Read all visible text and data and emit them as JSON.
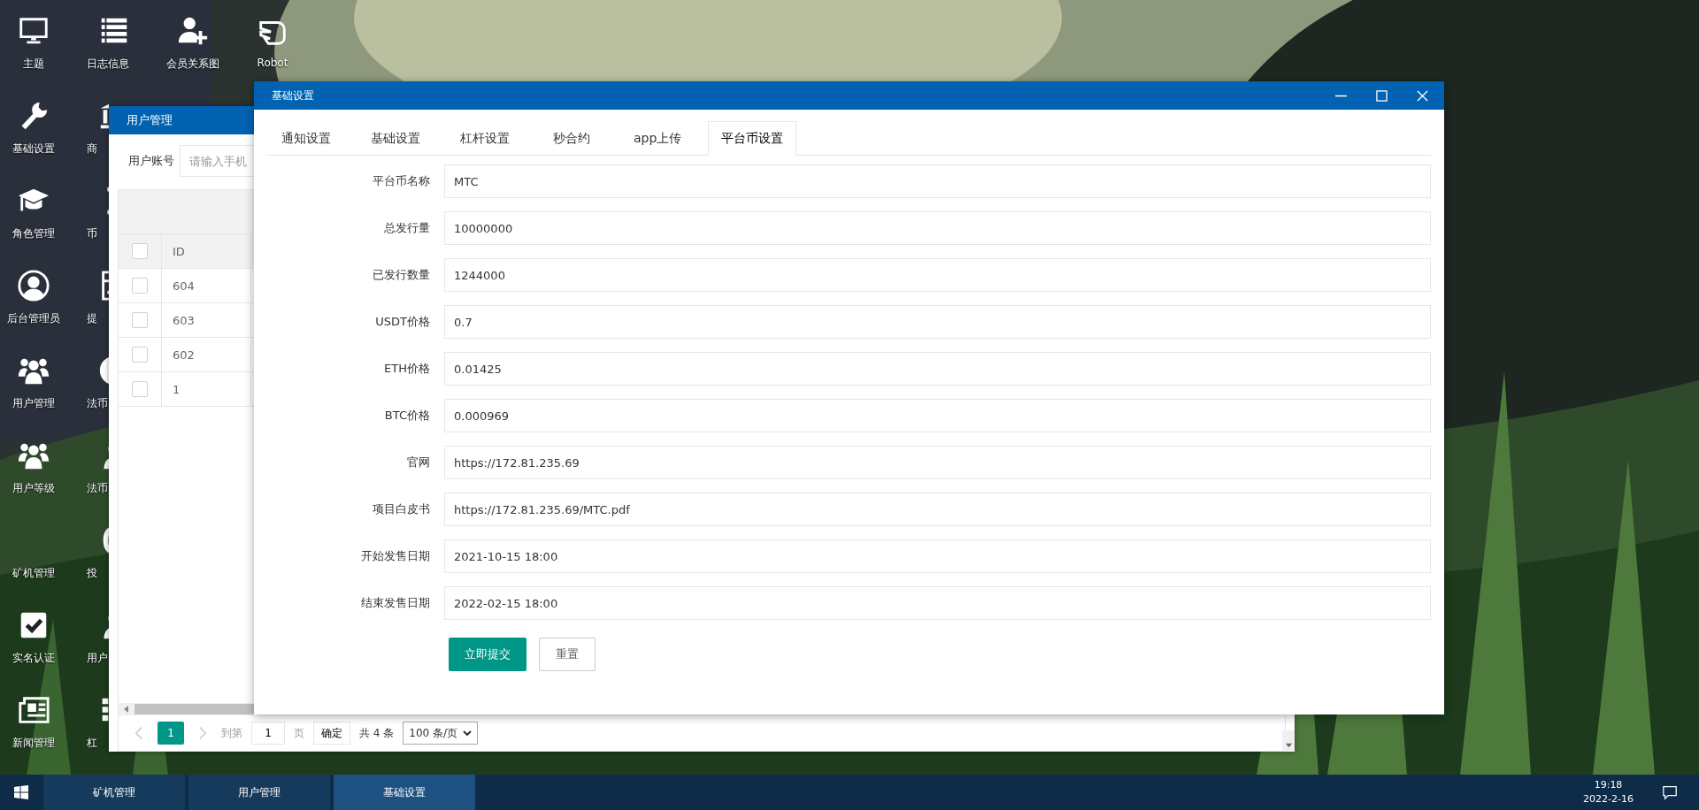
{
  "desktop": {
    "columns": [
      [
        {
          "label": "主题"
        },
        {
          "label": "基础设置"
        },
        {
          "label": "角色管理"
        },
        {
          "label": "后台管理员"
        },
        {
          "label": "用户管理"
        },
        {
          "label": "用户等级"
        },
        {
          "label": "矿机管理"
        },
        {
          "label": "实名认证"
        },
        {
          "label": "新闻管理"
        }
      ],
      [
        {
          "label": "日志信息"
        },
        {
          "label": "商"
        },
        {
          "label": "币"
        },
        {
          "label": "提"
        },
        {
          "label": "法币"
        },
        {
          "label": "法币"
        },
        {
          "label": "投"
        },
        {
          "label": "用户"
        },
        {
          "label": "杠"
        }
      ],
      [
        {
          "label": "会员关系图"
        }
      ],
      [
        {
          "label": "Robot"
        }
      ]
    ]
  },
  "user_window": {
    "title": "用户管理",
    "search_label": "用户账号",
    "search_placeholder": "请输入手机",
    "table": {
      "columns": [
        "ID"
      ],
      "header_checked": false,
      "rows": [
        {
          "id": "604",
          "checked": false
        },
        {
          "id": "603",
          "checked": false
        },
        {
          "id": "602",
          "checked": false
        },
        {
          "id": "1",
          "checked": false
        }
      ]
    },
    "pagination": {
      "pages": [
        {
          "label": "1",
          "selected": true
        }
      ],
      "goto_label": "到第",
      "goto_value": "1",
      "page_unit": "页",
      "confirm": "确定",
      "total": "共 4 条",
      "page_size": "100 条/页"
    }
  },
  "dialog": {
    "title": "基础设置",
    "tabs": [
      {
        "label": "通知设置",
        "selected": false
      },
      {
        "label": "基础设置",
        "selected": false
      },
      {
        "label": "杠杆设置",
        "selected": false
      },
      {
        "label": "秒合约",
        "selected": false
      },
      {
        "label": "app上传",
        "selected": false
      },
      {
        "label": "平台币设置",
        "selected": true
      }
    ],
    "fields": [
      {
        "label": "平台币名称",
        "value": "MTC"
      },
      {
        "label": "总发行量",
        "value": "10000000"
      },
      {
        "label": "已发行数量",
        "value": "1244000"
      },
      {
        "label": "USDT价格",
        "value": "0.7"
      },
      {
        "label": "ETH价格",
        "value": "0.01425"
      },
      {
        "label": "BTC价格",
        "value": "0.000969"
      },
      {
        "label": "官网",
        "value": "https://172.81.235.69"
      },
      {
        "label": "项目白皮书",
        "value": "https://172.81.235.69/MTC.pdf"
      },
      {
        "label": "开始发售日期",
        "value": "2021-10-15 18:00"
      },
      {
        "label": "结束发售日期",
        "value": "2022-02-15 18:00"
      }
    ],
    "buttons": [
      {
        "label": "立即提交",
        "kind": "primary"
      },
      {
        "label": "重置",
        "kind": "default"
      }
    ]
  },
  "taskbar": {
    "tasks": [
      {
        "label": "矿机管理",
        "selected": false
      },
      {
        "label": "用户管理",
        "selected": false
      },
      {
        "label": "基础设置",
        "selected": true
      }
    ],
    "time": "19:18",
    "date": "2022-2-16"
  }
}
